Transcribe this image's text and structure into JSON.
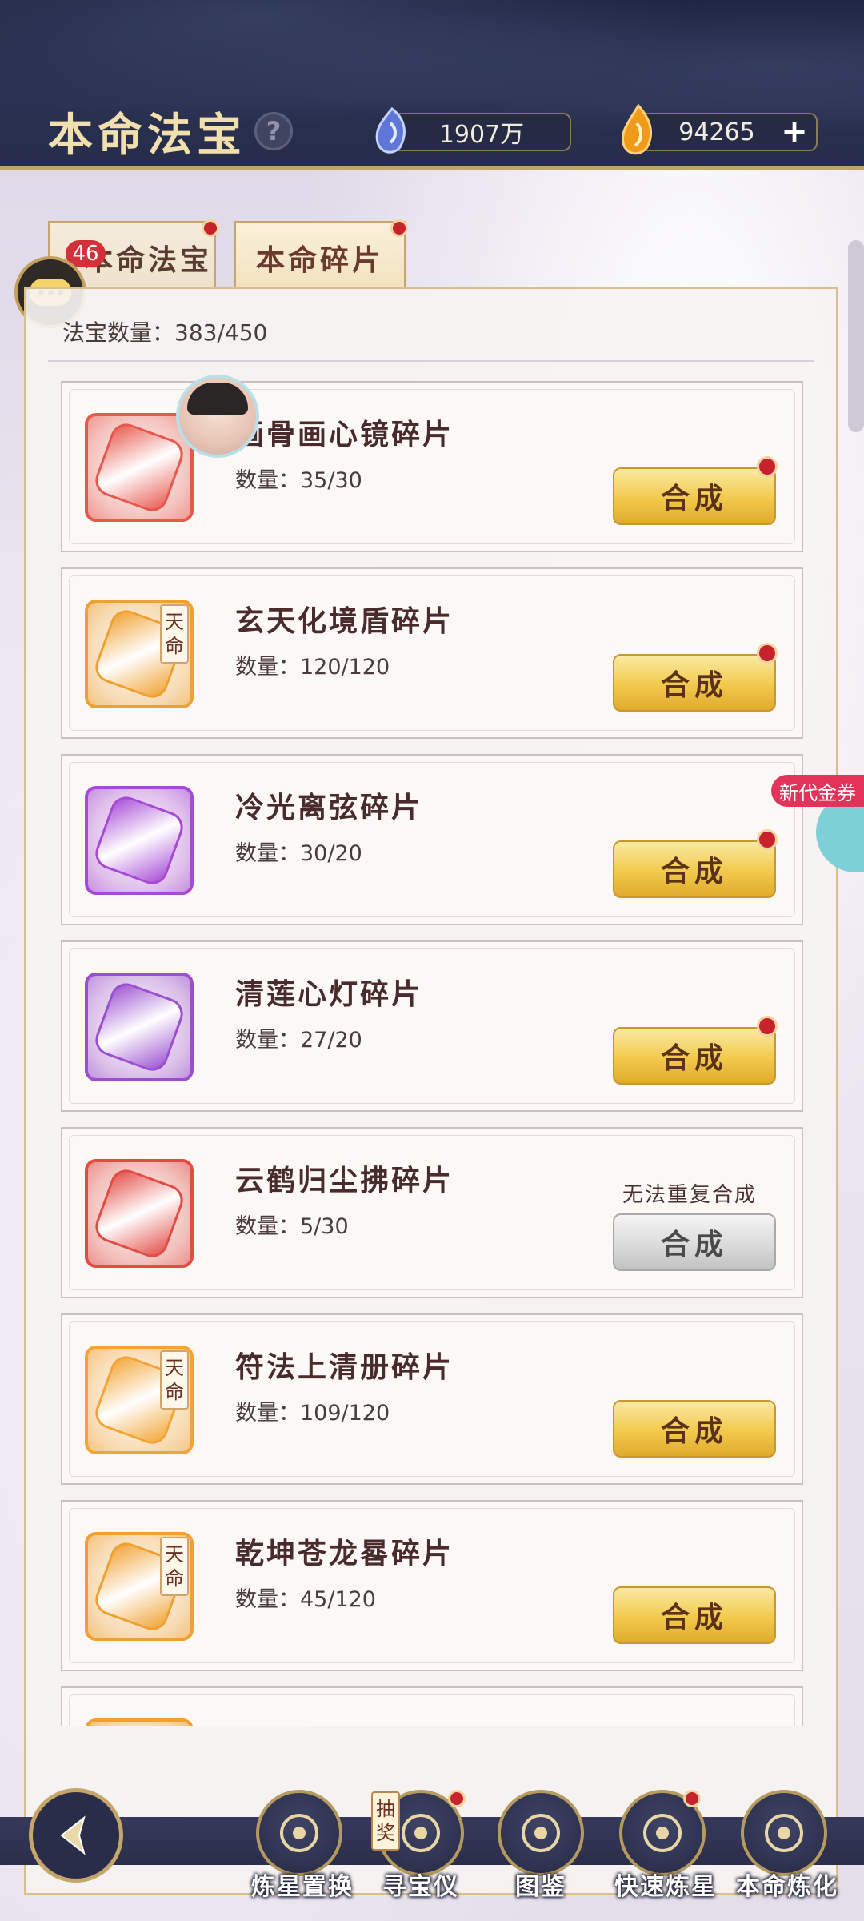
{
  "header": {
    "title": "本命法宝",
    "help": "?",
    "currency_spirit": "1907万",
    "currency_fire": "94265",
    "plus": "+"
  },
  "tabs": [
    {
      "label": "本命法宝",
      "badge": "46"
    },
    {
      "label": "本命碎片"
    }
  ],
  "count_label": "法宝数量：383/450",
  "items": [
    {
      "name": "画骨画心镜碎片",
      "qty": "数量：35/30",
      "button": "合成",
      "tianming": false,
      "color": "#e8574e"
    },
    {
      "name": "玄天化境盾碎片",
      "qty": "数量：120/120",
      "button": "合成",
      "tianming": true,
      "color": "#f0a030"
    },
    {
      "name": "冷光离弦碎片",
      "qty": "数量：30/20",
      "button": "合成",
      "tianming": false,
      "color": "#a64ad6"
    },
    {
      "name": "清莲心灯碎片",
      "qty": "数量：27/20",
      "button": "合成",
      "tianming": false,
      "color": "#9a4fd0"
    },
    {
      "name": "云鹤归尘拂碎片",
      "qty": "数量：5/30",
      "button": "合成",
      "tianming": false,
      "color": "#e34b45",
      "note": "无法重复合成"
    },
    {
      "name": "符法上清册碎片",
      "qty": "数量：109/120",
      "button": "合成",
      "tianming": true,
      "color": "#f3a434"
    },
    {
      "name": "乾坤苍龙晷碎片",
      "qty": "数量：45/120",
      "button": "合成",
      "tianming": true,
      "color": "#f0a030"
    },
    {
      "name": "",
      "qty": "",
      "button": "",
      "tianming": false,
      "color": "#f0a030"
    }
  ],
  "tianming_label": [
    "天",
    "命"
  ],
  "voucher": "新代金券",
  "nav": {
    "lottery_tag": [
      "抽",
      "奖"
    ],
    "items": [
      "炼星置换",
      "寻宝仪",
      "图鉴",
      "快速炼星",
      "本命炼化"
    ]
  }
}
